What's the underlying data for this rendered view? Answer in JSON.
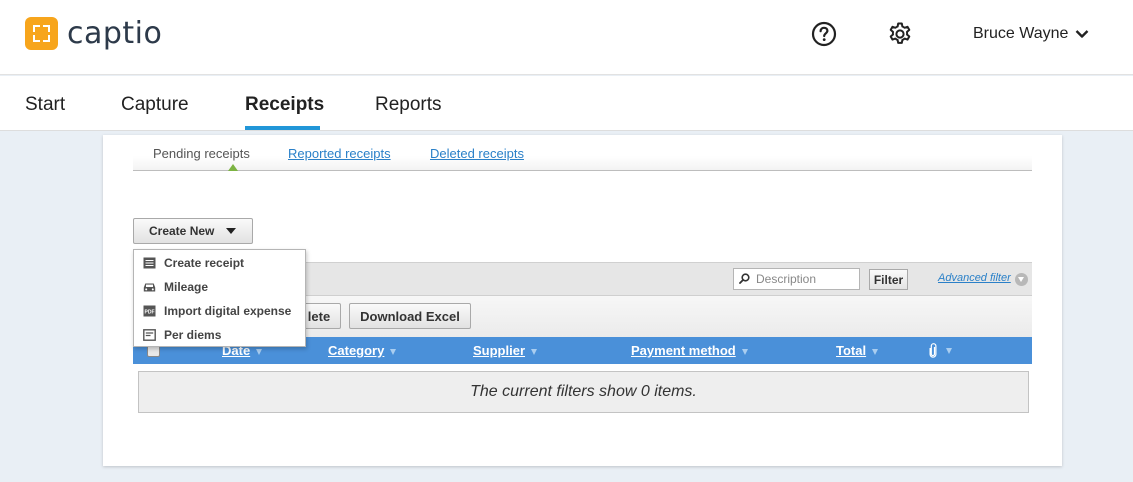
{
  "brand": {
    "name": "captio",
    "accent": "#f7a51c"
  },
  "header": {
    "help_icon": "question-circle-icon",
    "settings_icon": "gear-icon",
    "user_name": "Bruce Wayne"
  },
  "main_nav": {
    "items": [
      {
        "label": "Start",
        "active": false
      },
      {
        "label": "Capture",
        "active": false
      },
      {
        "label": "Receipts",
        "active": true
      },
      {
        "label": "Reports",
        "active": false
      }
    ],
    "active_color": "#2196d8"
  },
  "sub_nav": {
    "items": [
      {
        "label": "Pending receipts",
        "current": true
      },
      {
        "label": "Reported receipts",
        "current": false
      },
      {
        "label": "Deleted receipts",
        "current": false
      }
    ]
  },
  "create_new": {
    "label": "Create New",
    "menu": [
      {
        "label": "Create receipt",
        "icon": "receipt-list-icon"
      },
      {
        "label": "Mileage",
        "icon": "car-icon"
      },
      {
        "label": "Import digital expense",
        "icon": "pdf-icon"
      },
      {
        "label": "Per diems",
        "icon": "per-diem-card-icon"
      }
    ]
  },
  "filter": {
    "search_placeholder": "Description",
    "search_value": "",
    "filter_button": "Filter",
    "advanced_filter": "Advanced filter"
  },
  "actions": {
    "delete_label": "lete",
    "download_excel": "Download Excel"
  },
  "table": {
    "header_color": "#4a90d9",
    "columns": [
      "Date",
      "Category",
      "Supplier",
      "Payment method",
      "Total"
    ],
    "attachment_icon": "paperclip-icon",
    "rows": [],
    "empty_message": "The current filters show 0 items."
  }
}
